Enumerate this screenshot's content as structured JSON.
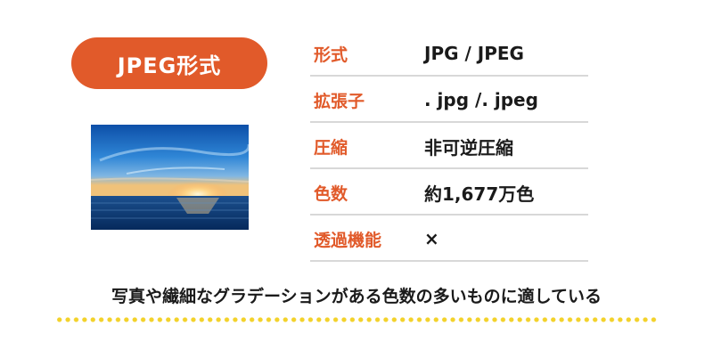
{
  "badge": {
    "label": "JPEG形式"
  },
  "specs": [
    {
      "label": "形式",
      "value": "JPG / JPEG"
    },
    {
      "label": "拡張子",
      "value": ". jpg /. jpeg"
    },
    {
      "label": "圧縮",
      "value": "非可逆圧縮"
    },
    {
      "label": "色数",
      "value": "約1,677万色"
    },
    {
      "label": "透過機能",
      "value": "×"
    }
  ],
  "caption": "写真や繊細なグラデーションがある色数の多いものに適している",
  "colors": {
    "accent": "#e15a2a",
    "divider": "#d8d8d8",
    "dots": "#f3d22b"
  }
}
